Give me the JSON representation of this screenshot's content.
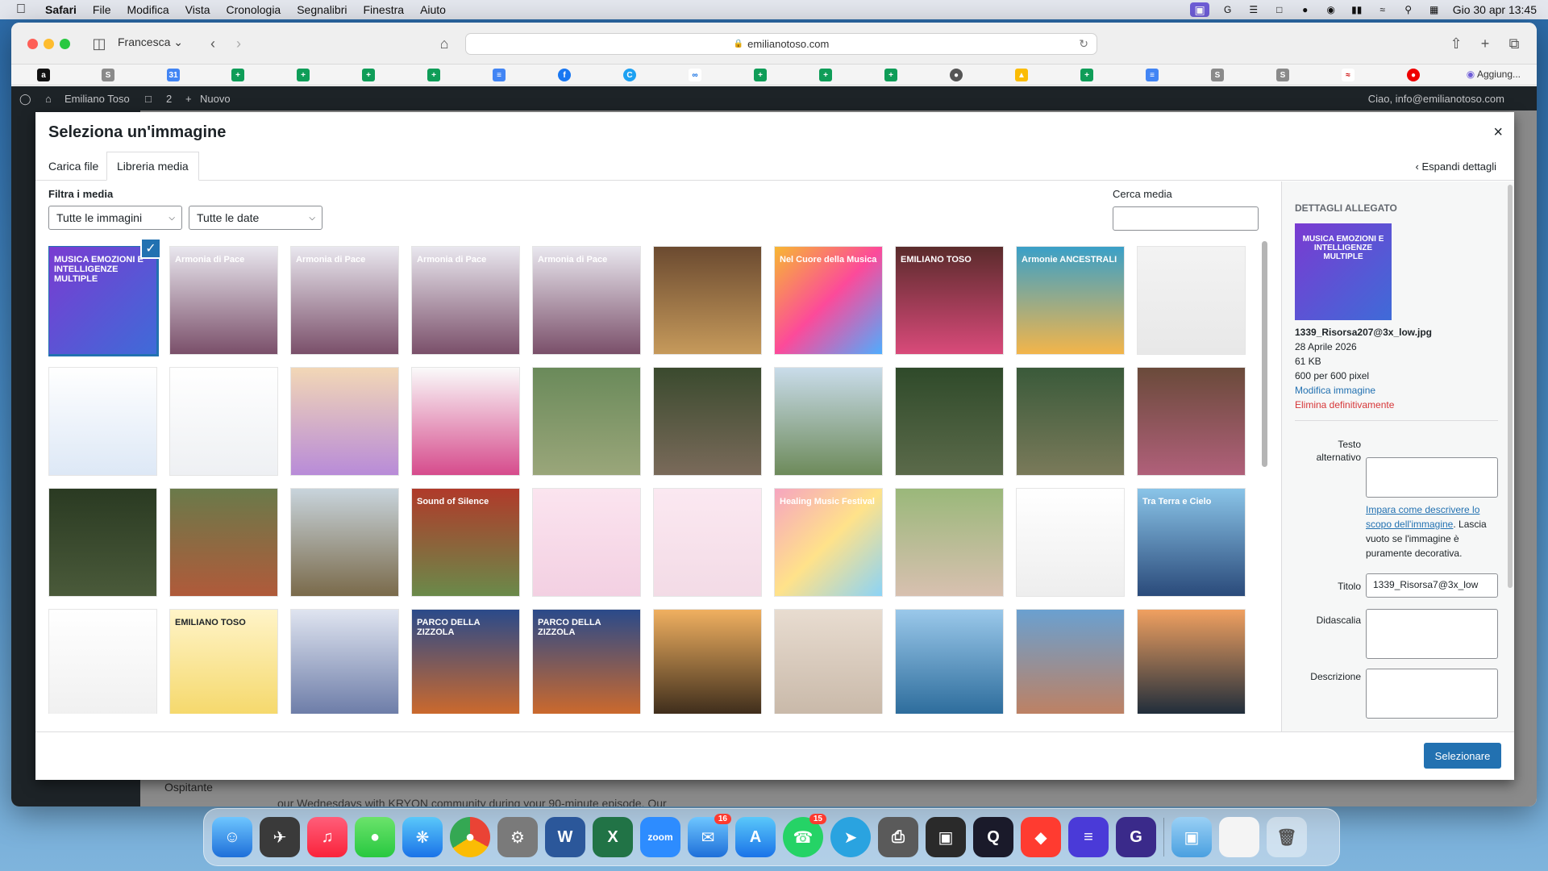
{
  "menubar": {
    "items": [
      "Safari",
      "File",
      "Modifica",
      "Vista",
      "Cronologia",
      "Segnalibri",
      "Finestra",
      "Aiuto"
    ],
    "clock": "Gio 30 apr  13:45"
  },
  "browser": {
    "profile": "Francesca",
    "url": "emilianotoso.com",
    "favorites_more": "Aggiung..."
  },
  "wp": {
    "site_name": "Emiliano Toso",
    "comments": "2",
    "new": "Nuovo",
    "greeting": "Ciao, info@emilianotoso.com",
    "bg_text1": "Ospitante",
    "bg_text2": "our Wednesdays with KRYON community during your 90-minute episode. Our"
  },
  "modal": {
    "title": "Seleziona un'immagine",
    "close": "×",
    "tabs": [
      "Carica file",
      "Libreria media"
    ],
    "expand": "Espandi dettagli",
    "filter_label": "Filtra i media",
    "filter_type": "Tutte le immagini",
    "filter_date": "Tutte le date",
    "search_label": "Cerca media",
    "select_button": "Selezionare"
  },
  "thumbs": [
    {
      "bg": "linear-gradient(135deg,#7a3bd1,#3f6bd8)",
      "cap": "MUSICA EMOZIONI E INTELLIGENZE MULTIPLE"
    },
    {
      "bg": "linear-gradient(180deg,#e9e7ef,#7a4f6a)",
      "cap": "Armonia di Pace"
    },
    {
      "bg": "linear-gradient(180deg,#e9e7ef,#7a4f6a)",
      "cap": "Armonia di Pace"
    },
    {
      "bg": "linear-gradient(180deg,#e9e7ef,#7a4f6a)",
      "cap": "Armonia di Pace"
    },
    {
      "bg": "linear-gradient(180deg,#e9e7ef,#7a4f6a)",
      "cap": "Armonia di Pace"
    },
    {
      "bg": "linear-gradient(180deg,#6b4a30,#c69a5b)",
      "cap": ""
    },
    {
      "bg": "linear-gradient(135deg,#f7b733,#fc4a9a,#4facfe)",
      "cap": "Nel Cuore della Musica"
    },
    {
      "bg": "linear-gradient(180deg,#5a2b2b,#d94a7a)",
      "cap": "EMILIANO TOSO"
    },
    {
      "bg": "linear-gradient(180deg,#3aa0c8,#f3b54a)",
      "cap": "Armonie ANCESTRALI"
    },
    {
      "bg": "linear-gradient(180deg,#f3f3f3,#e8e8e8)",
      "cap": ""
    },
    {
      "bg": "linear-gradient(180deg,#ffffff,#dde8f6)",
      "cap": ""
    },
    {
      "bg": "linear-gradient(180deg,#ffffff,#eef0f3)",
      "cap": ""
    },
    {
      "bg": "linear-gradient(180deg,#f2d7b6,#b88bd8)",
      "cap": ""
    },
    {
      "bg": "linear-gradient(180deg,#fafafa,#d64b8c)",
      "cap": ""
    },
    {
      "bg": "linear-gradient(180deg,#6a8a5a,#9aa67a)",
      "cap": ""
    },
    {
      "bg": "linear-gradient(180deg,#3a4a2e,#7a6a5a)",
      "cap": ""
    },
    {
      "bg": "linear-gradient(180deg,#c9dcea,#6d8a5a)",
      "cap": ""
    },
    {
      "bg": "linear-gradient(180deg,#2f4a2a,#5b6a4a)",
      "cap": ""
    },
    {
      "bg": "linear-gradient(180deg,#3a5a3a,#7a7a5a)",
      "cap": ""
    },
    {
      "bg": "linear-gradient(180deg,#6a4a3a,#b0607a)",
      "cap": ""
    },
    {
      "bg": "linear-gradient(180deg,#2a3a22,#4a5a3a)",
      "cap": ""
    },
    {
      "bg": "linear-gradient(180deg,#6a7a4a,#b05a3a)",
      "cap": ""
    },
    {
      "bg": "linear-gradient(180deg,#c8d4dc,#7a6a4a)",
      "cap": ""
    },
    {
      "bg": "linear-gradient(180deg,#b03a2a,#6a8a4a)",
      "cap": "Sound of Silence"
    },
    {
      "bg": "linear-gradient(180deg,#fbe4ef,#f3d0e2)",
      "cap": ""
    },
    {
      "bg": "linear-gradient(180deg,#fbe8f1,#f3dbe6)",
      "cap": ""
    },
    {
      "bg": "linear-gradient(135deg,#f6a5c0,#ffe28a,#8bd3f6)",
      "cap": "Healing Music Festival"
    },
    {
      "bg": "linear-gradient(180deg,#9ab87a,#d8c0b0)",
      "cap": ""
    },
    {
      "bg": "linear-gradient(180deg,#ffffff,#eeeeee)",
      "cap": ""
    },
    {
      "bg": "linear-gradient(180deg,#8ac4e8,#2a4a7a)",
      "cap": "Tra Terra e Cielo"
    },
    {
      "bg": "linear-gradient(180deg,#ffffff,#f0f0f0)",
      "cap": ""
    },
    {
      "bg": "linear-gradient(180deg,#fff4c8,#f5d86a)",
      "cap": "EMILIANO TOSO"
    },
    {
      "bg": "linear-gradient(180deg,#dfe4f0,#6a7aa6)",
      "cap": ""
    },
    {
      "bg": "linear-gradient(180deg,#2a4a8a,#d06a2a)",
      "cap": "PARCO DELLA ZIZZOLA"
    },
    {
      "bg": "linear-gradient(180deg,#2a4a8a,#d06a2a)",
      "cap": "PARCO DELLA ZIZZOLA"
    },
    {
      "bg": "linear-gradient(180deg,#f0b060,#3a2a1a)",
      "cap": ""
    },
    {
      "bg": "linear-gradient(180deg,#e8dcd0,#c8b8a8)",
      "cap": ""
    },
    {
      "bg": "linear-gradient(180deg,#9ac8ea,#2a6a9a)",
      "cap": ""
    },
    {
      "bg": "linear-gradient(180deg,#6aa0d0,#c08060)",
      "cap": ""
    },
    {
      "bg": "linear-gradient(180deg,#f0a060,#1a2a3a)",
      "cap": ""
    }
  ],
  "details": {
    "heading": "Dettagli allegato",
    "filename": "1339_Risorsa207@3x_low.jpg",
    "date": "28 Aprile 2026",
    "size": "61 KB",
    "dimensions": "600 per 600 pixel",
    "edit_link": "Modifica immagine",
    "delete_link": "Elimina definitivamente",
    "alt_label": "Testo alternativo",
    "help_link": "Impara come descrivere lo scopo dell'immagine",
    "help_text": ". Lascia vuoto se l'immagine è puramente decorativa.",
    "title_label": "Titolo",
    "title_value": "1339_Risorsa7@3x_low",
    "caption_label": "Didascalia",
    "desc_label": "Descrizione"
  },
  "dock": {
    "mail_badge": "16",
    "whatsapp_badge": "15"
  },
  "colors": {
    "wp_blue": "#2271b1",
    "wp_dark": "#1d2327",
    "danger": "#d63638"
  }
}
